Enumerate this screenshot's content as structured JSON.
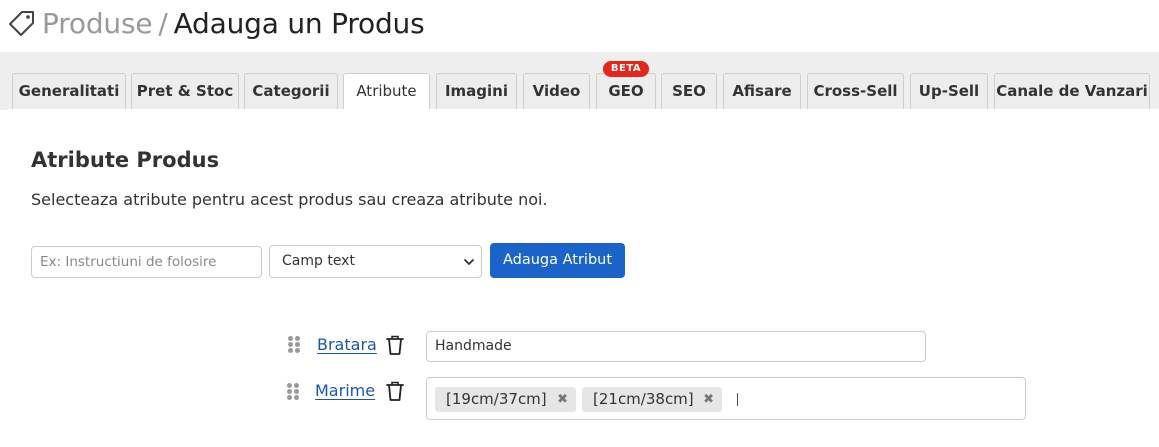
{
  "header": {
    "section": "Produse",
    "separator": "/",
    "page": "Adauga un Produs",
    "icon": "tag-icon"
  },
  "tabs": [
    {
      "label": "Generalitati",
      "active": false
    },
    {
      "label": "Pret & Stoc",
      "active": false
    },
    {
      "label": "Categorii",
      "active": false
    },
    {
      "label": "Atribute",
      "active": true
    },
    {
      "label": "Imagini",
      "active": false
    },
    {
      "label": "Video",
      "active": false
    },
    {
      "label": "GEO",
      "active": false,
      "badge": "BETA"
    },
    {
      "label": "SEO",
      "active": false
    },
    {
      "label": "Afisare",
      "active": false
    },
    {
      "label": "Cross-Sell",
      "active": false
    },
    {
      "label": "Up-Sell",
      "active": false
    },
    {
      "label": "Canale de Vanzari",
      "active": false
    }
  ],
  "attributes_section": {
    "title": "Atribute Produs",
    "description": "Selecteaza atribute pentru acest produs sau creaza atribute noi.",
    "name_input": {
      "placeholder": "Ex: Instructiuni de folosire",
      "value": ""
    },
    "type_select": {
      "selected": "Camp text"
    },
    "add_button": "Adauga Atribut"
  },
  "attributes": [
    {
      "name": "Bratara",
      "value": "Handmade"
    },
    {
      "name": "Marime",
      "tags": [
        "[19cm/37cm]",
        "[21cm/38cm]"
      ],
      "remove_glyph": "✖"
    }
  ],
  "colors": {
    "primary_button": "#1a63c9",
    "link": "#1a56b0",
    "beta_badge": "#e4271b",
    "tab_bg": "#ededed"
  }
}
